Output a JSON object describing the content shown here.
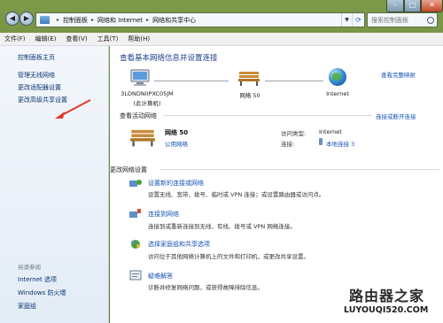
{
  "address": {
    "crumbs": [
      "控制面板",
      "网络和 Internet",
      "网络和共享中心"
    ],
    "search_placeholder": "搜索控制面板"
  },
  "menu": [
    "文件(F)",
    "编辑(E)",
    "查看(V)",
    "工具(T)",
    "帮助(H)"
  ],
  "nav": {
    "home": "控制面板主页",
    "links": [
      "管理无线网络",
      "更改适配器设置",
      "更改高级共享设置"
    ],
    "see_also_title": "另请参阅",
    "see_also": [
      "Internet 选项",
      "Windows 防火墙",
      "家庭组"
    ]
  },
  "main": {
    "title": "查看基本网络信息并设置连接",
    "full_map": "查看完整映射",
    "nodes": {
      "computer_name": "3LDNDNIIPXC05JM",
      "computer_sub": "(此计算机)",
      "network": "网络  50",
      "internet": "Internet"
    },
    "active_head": "查看活动网络",
    "connect_disconnect": "连接或断开连接",
    "active": {
      "name": "网络  50",
      "type": "公用网络",
      "access_label": "访问类型:",
      "access_value": "Internet",
      "conn_label": "连接:",
      "conn_value": "本地连接 3"
    },
    "change_head": "更改网络设置",
    "tasks": [
      {
        "title": "设置新的连接或网络",
        "desc": "设置无线、宽带、拨号、临时或 VPN 连接；或设置路由器或访问点。"
      },
      {
        "title": "连接到网络",
        "desc": "连接到或重新连接到无线、有线、拨号或 VPN 网络连接。"
      },
      {
        "title": "选择家庭组和共享选项",
        "desc": "访问位于其他网络计算机上的文件和打印机，或更改共享设置。"
      },
      {
        "title": "疑难解答",
        "desc": "诊断并修复网络问题，或获得故障排除信息。"
      }
    ]
  },
  "watermark": {
    "line1": "路由器之家",
    "line2": "LUYOUQI520.COM"
  },
  "colors": {
    "link": "#1452b8",
    "title": "#1c3e8c",
    "arrow": "#e23a2a"
  }
}
